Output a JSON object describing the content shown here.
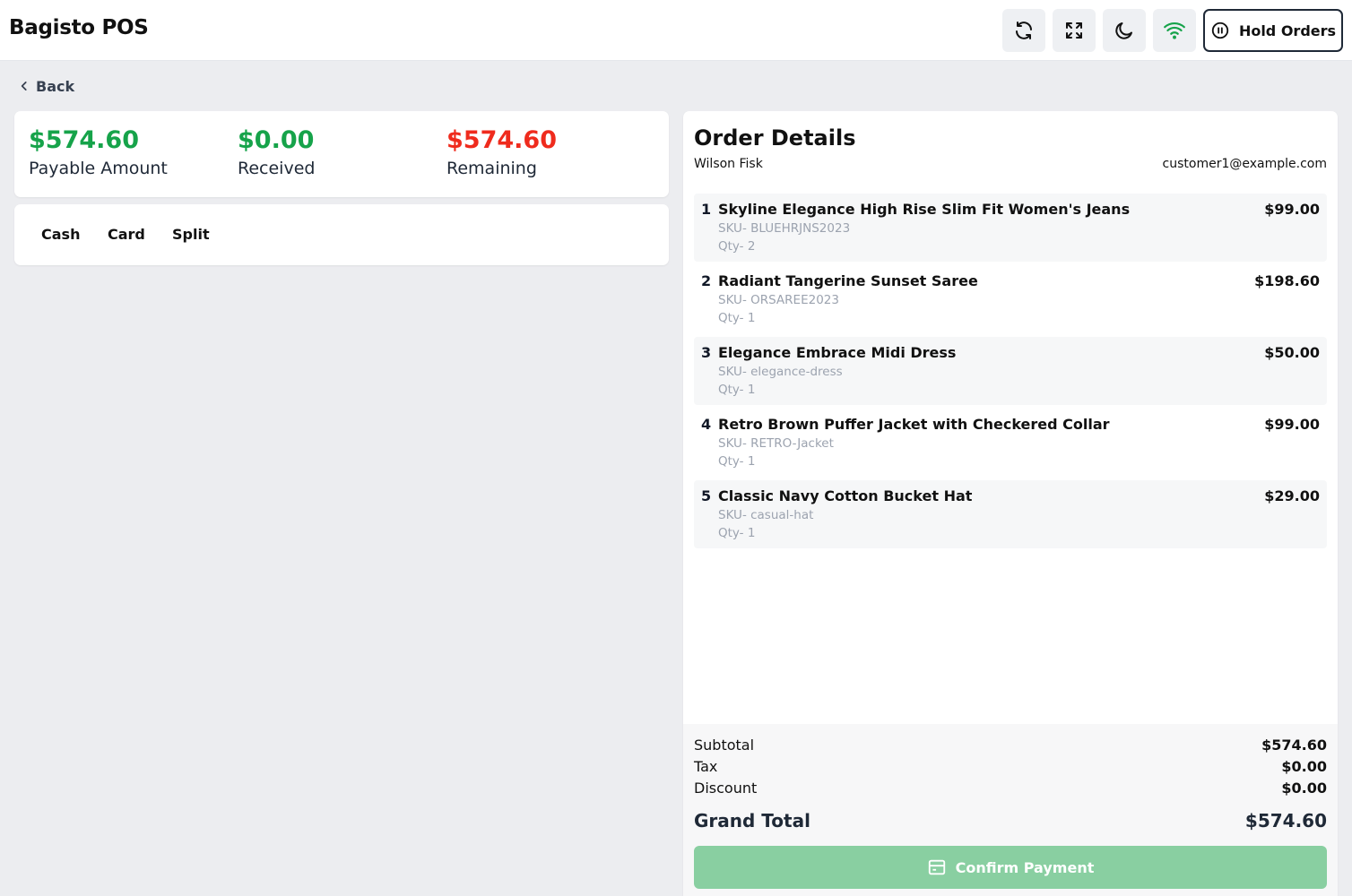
{
  "header": {
    "title": "Bagisto POS",
    "icons": [
      "refresh-icon",
      "fullscreen-icon",
      "dark-mode-icon",
      "wifi-icon"
    ],
    "hold_orders_label": "Hold Orders"
  },
  "back_label": "Back",
  "summary": {
    "payable": {
      "amount": "$574.60",
      "label": "Payable Amount"
    },
    "received": {
      "amount": "$0.00",
      "label": "Received"
    },
    "remaining": {
      "amount": "$574.60",
      "label": "Remaining"
    }
  },
  "payment_methods": [
    "Cash",
    "Card",
    "Split"
  ],
  "order": {
    "title": "Order Details",
    "customer_name": "Wilson Fisk",
    "customer_email": "customer1@example.com",
    "items": [
      {
        "num": "1",
        "name": "Skyline Elegance High Rise Slim Fit Women's Jeans",
        "sku": "SKU- BLUEHRJNS2023",
        "qty": "Qty- 2",
        "price": "$99.00"
      },
      {
        "num": "2",
        "name": "Radiant Tangerine Sunset Saree",
        "sku": "SKU- ORSAREE2023",
        "qty": "Qty- 1",
        "price": "$198.60"
      },
      {
        "num": "3",
        "name": "Elegance Embrace Midi Dress",
        "sku": "SKU- elegance-dress",
        "qty": "Qty- 1",
        "price": "$50.00"
      },
      {
        "num": "4",
        "name": "Retro Brown Puffer Jacket with Checkered Collar",
        "sku": "SKU- RETRO-Jacket",
        "qty": "Qty- 1",
        "price": "$99.00"
      },
      {
        "num": "5",
        "name": "Classic Navy Cotton Bucket Hat",
        "sku": "SKU- casual-hat",
        "qty": "Qty- 1",
        "price": "$29.00"
      }
    ],
    "subtotal": {
      "label": "Subtotal",
      "value": "$574.60"
    },
    "tax": {
      "label": "Tax",
      "value": "$0.00"
    },
    "discount": {
      "label": "Discount",
      "value": "$0.00"
    },
    "grand_total": {
      "label": "Grand Total",
      "value": "$574.60"
    },
    "confirm_label": "Confirm Payment"
  },
  "colors": {
    "positive": "#16a34a",
    "negative": "#ef2b1d",
    "confirm_button": "#89cfa1"
  }
}
